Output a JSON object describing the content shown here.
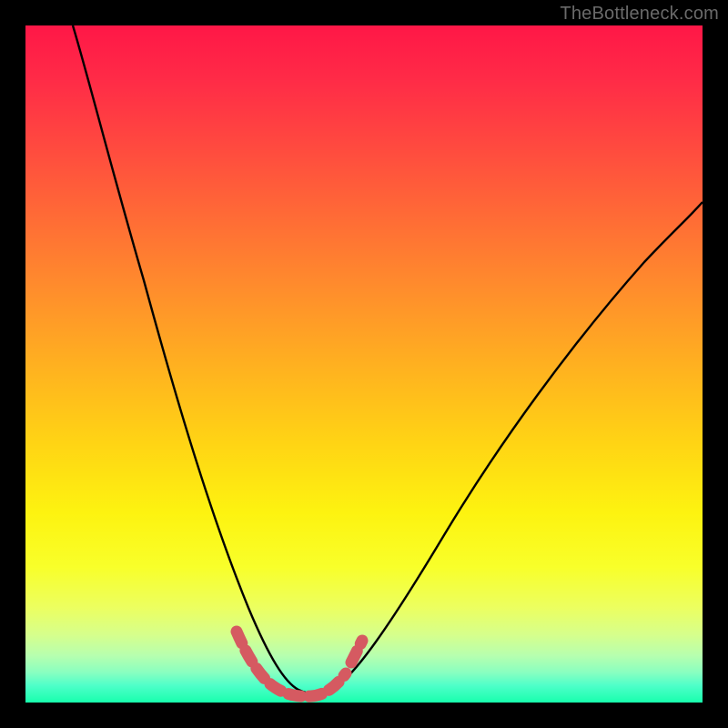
{
  "watermark": {
    "text": "TheBottleneck.com"
  },
  "chart_data": {
    "type": "line",
    "title": "",
    "xlabel": "",
    "ylabel": "",
    "xlim": [
      0,
      100
    ],
    "ylim": [
      0,
      100
    ],
    "grid": false,
    "legend": false,
    "series": [
      {
        "name": "bottleneck-curve",
        "color": "#000000",
        "x": [
          7,
          10,
          14,
          18,
          22,
          26,
          30,
          33,
          36,
          38,
          40,
          42,
          44,
          48,
          52,
          56,
          60,
          66,
          74,
          82,
          90,
          100
        ],
        "y": [
          100,
          90,
          78,
          66,
          54,
          42,
          30,
          21,
          13,
          8,
          5,
          3,
          3,
          5,
          9,
          14,
          20,
          28,
          40,
          52,
          62,
          74
        ]
      },
      {
        "name": "highlight-segment",
        "color": "#d55a61",
        "x": [
          30,
          32,
          34,
          36,
          38,
          40,
          42,
          44,
          46,
          48
        ],
        "y": [
          12,
          8,
          5,
          3,
          2,
          2,
          2,
          3,
          5,
          8
        ]
      }
    ],
    "background_gradient": {
      "top": "#ff1747",
      "mid": "#ffd514",
      "bottom": "#18ffad"
    }
  }
}
